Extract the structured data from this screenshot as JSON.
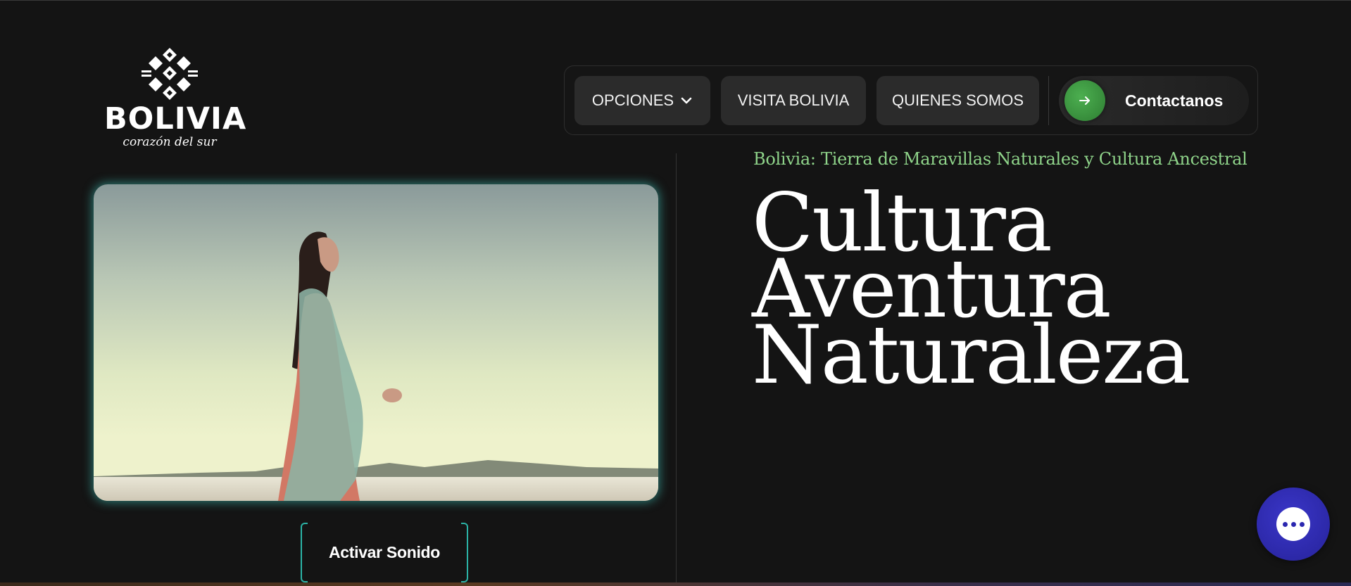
{
  "brand": {
    "name": "BOLIVIA",
    "tagline": "corazón del sur"
  },
  "nav": {
    "options_label": "OPCIONES",
    "visit_label": "VISITA BOLIVIA",
    "about_label": "QUIENES SOMOS",
    "contact_label": "Contactanos"
  },
  "hero": {
    "subtitle": "Bolivia: Tierra de Maravillas Naturales y Cultura Ancestral",
    "words": [
      "Cultura",
      "Aventura",
      "Naturaleza"
    ]
  },
  "video": {
    "sound_button": "Activar Sonido"
  },
  "icons": {
    "options_chevron": "chevron-down-icon",
    "contact_arrow": "arrow-right-icon",
    "chat": "chat-bubble-icon"
  },
  "colors": {
    "background": "#141414",
    "accent_green": "#8fd48a",
    "contact_green": "#4caf50",
    "glow_teal": "#2bb3a6",
    "chat_blue": "#2b27b0"
  }
}
